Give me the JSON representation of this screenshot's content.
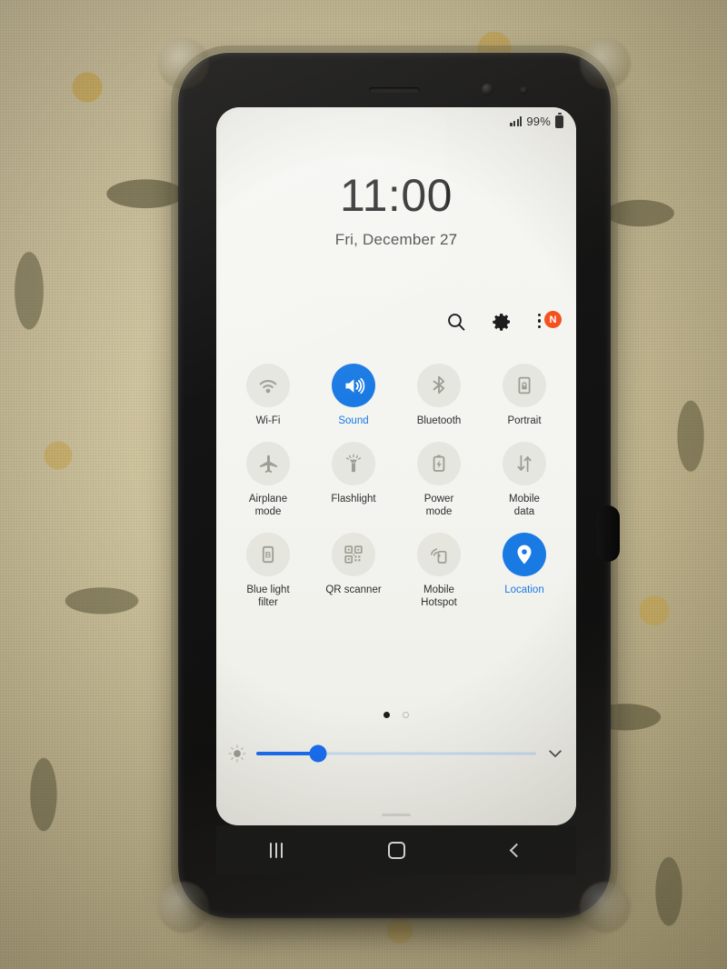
{
  "device": {
    "hardware": {
      "earpiece": "earpiece-speaker",
      "front_camera": "front-camera",
      "power_button": "power-button"
    }
  },
  "status_bar": {
    "signal_icon": "signal-bars-icon",
    "battery_percent": "99%",
    "battery_icon": "battery-icon"
  },
  "lock_clock": {
    "time": "11:00",
    "date": "Fri, December 27"
  },
  "quick_settings_header": {
    "search_icon": "search-icon",
    "settings_icon": "gear-icon",
    "more_icon": "kebab-menu-icon",
    "update_badge": "N"
  },
  "tiles": [
    {
      "label": "Wi-Fi",
      "icon": "wifi-icon",
      "state": "off"
    },
    {
      "label": "Sound",
      "icon": "sound-icon",
      "state": "on"
    },
    {
      "label": "Bluetooth",
      "icon": "bluetooth-icon",
      "state": "off"
    },
    {
      "label": "Portrait",
      "icon": "rotation-lock-icon",
      "state": "off"
    },
    {
      "label": "Airplane\nmode",
      "icon": "airplane-icon",
      "state": "off"
    },
    {
      "label": "Flashlight",
      "icon": "flashlight-icon",
      "state": "off"
    },
    {
      "label": "Power\nmode",
      "icon": "power-mode-icon",
      "state": "off"
    },
    {
      "label": "Mobile\ndata",
      "icon": "mobile-data-icon",
      "state": "off"
    },
    {
      "label": "Blue light\nfilter",
      "icon": "blue-light-icon",
      "state": "off"
    },
    {
      "label": "QR scanner",
      "icon": "qr-code-icon",
      "state": "off"
    },
    {
      "label": "Mobile\nHotspot",
      "icon": "hotspot-icon",
      "state": "off"
    },
    {
      "label": "Location",
      "icon": "location-pin-icon",
      "state": "on"
    }
  ],
  "pager": {
    "total_pages": 2,
    "active_page": 1
  },
  "brightness": {
    "icon": "brightness-icon",
    "value_percent": 22,
    "expand_icon": "chevron-down-icon"
  },
  "nav_bar": {
    "recents": "recents-icon",
    "home": "home-icon",
    "back": "back-icon"
  },
  "colors": {
    "accent_blue": "#1a7ae4",
    "slider_blue": "#1a6ef0",
    "badge_orange": "#f4511e",
    "tile_off_gray": "#9d9d92",
    "screen_bg": "#f4f4f0"
  }
}
